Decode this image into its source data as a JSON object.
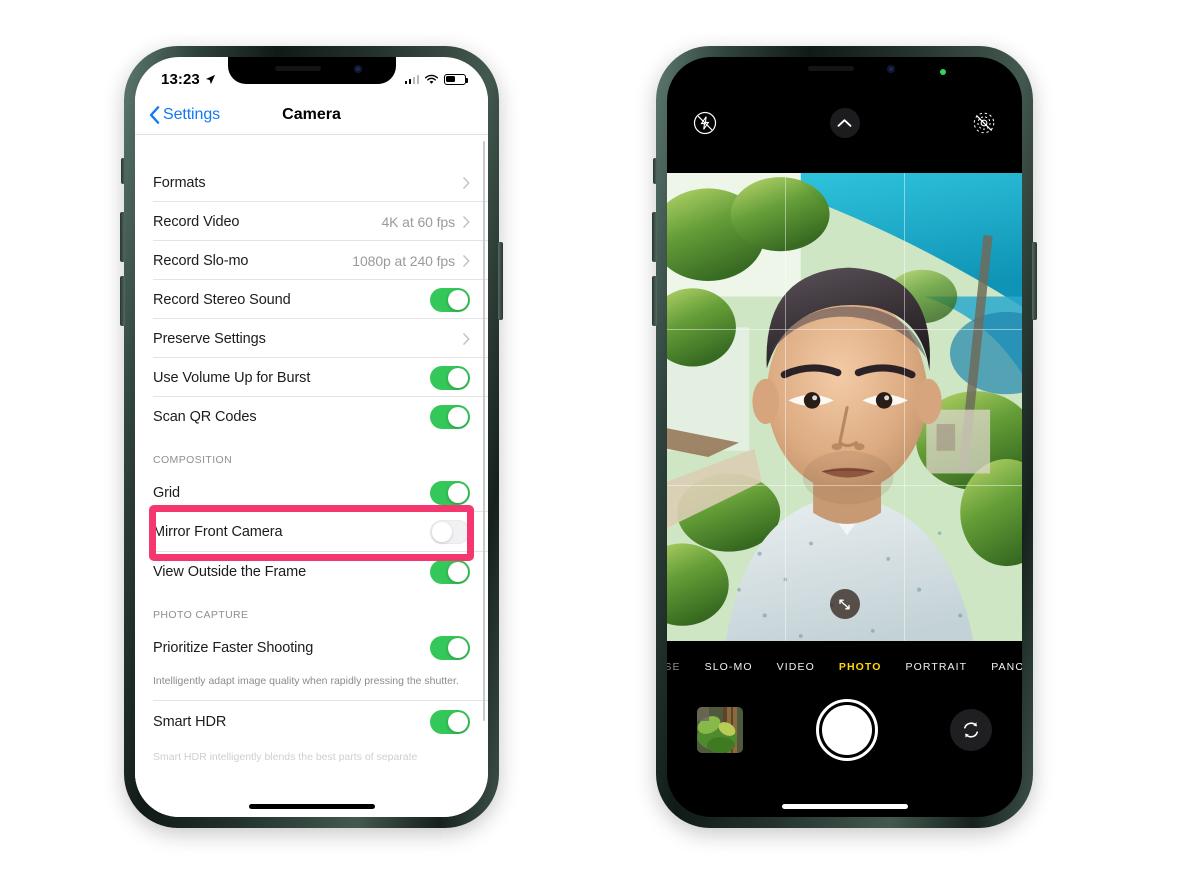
{
  "left_phone": {
    "status_bar": {
      "time": "13:23",
      "location_icon": "location-arrow-icon",
      "signal_icon": "cellular-signal-icon",
      "wifi_icon": "wifi-icon",
      "battery_icon": "battery-icon"
    },
    "nav": {
      "back_label": "Settings",
      "back_icon": "chevron-left-icon",
      "title": "Camera"
    },
    "rows": [
      {
        "label": "Formats",
        "type": "disclosure",
        "value": ""
      },
      {
        "label": "Record Video",
        "type": "disclosure",
        "value": "4K at 60 fps"
      },
      {
        "label": "Record Slo-mo",
        "type": "disclosure",
        "value": "1080p at 240 fps"
      },
      {
        "label": "Record Stereo Sound",
        "type": "toggle",
        "on": true
      },
      {
        "label": "Preserve Settings",
        "type": "disclosure",
        "value": ""
      },
      {
        "label": "Use Volume Up for Burst",
        "type": "toggle",
        "on": true
      },
      {
        "label": "Scan QR Codes",
        "type": "toggle",
        "on": true
      }
    ],
    "composition": {
      "header": "COMPOSITION",
      "rows": [
        {
          "label": "Grid",
          "type": "toggle",
          "on": true
        },
        {
          "label": "Mirror Front Camera",
          "type": "toggle",
          "on": false,
          "highlighted": true
        },
        {
          "label": "View Outside the Frame",
          "type": "toggle",
          "on": true
        }
      ]
    },
    "photo_capture": {
      "header": "PHOTO CAPTURE",
      "rows": [
        {
          "label": "Prioritize Faster Shooting",
          "type": "toggle",
          "on": true
        }
      ],
      "footnote": "Intelligently adapt image quality when rapidly pressing the shutter.",
      "rows2": [
        {
          "label": "Smart HDR",
          "type": "toggle",
          "on": true
        }
      ],
      "footnote2": "Smart HDR intelligently blends the best parts of separate"
    },
    "highlight_color": "#f5376f"
  },
  "right_phone": {
    "camera": {
      "top_controls": [
        {
          "name": "flash-off-icon",
          "label": "Flash Off"
        },
        {
          "name": "chevron-up-icon",
          "label": "More Controls"
        },
        {
          "name": "live-photo-off-icon",
          "label": "Live Photo Off"
        }
      ],
      "grid_overlay": true,
      "expand_button_icon": "expand-arrows-icon",
      "modes": [
        {
          "label": "SE",
          "active": false,
          "dim": true
        },
        {
          "label": "SLO-MO",
          "active": false,
          "dim": false
        },
        {
          "label": "VIDEO",
          "active": false,
          "dim": false
        },
        {
          "label": "PHOTO",
          "active": true,
          "dim": false
        },
        {
          "label": "PORTRAIT",
          "active": false,
          "dim": false
        },
        {
          "label": "PANO",
          "active": false,
          "dim": false
        }
      ],
      "active_mode_color": "#ffd60a",
      "bottom_controls": {
        "thumbnail_name": "photo-library-thumbnail",
        "shutter_name": "shutter-button",
        "flip_name": "camera-flip-icon"
      },
      "privacy_dot_color": "#3ad060"
    }
  }
}
